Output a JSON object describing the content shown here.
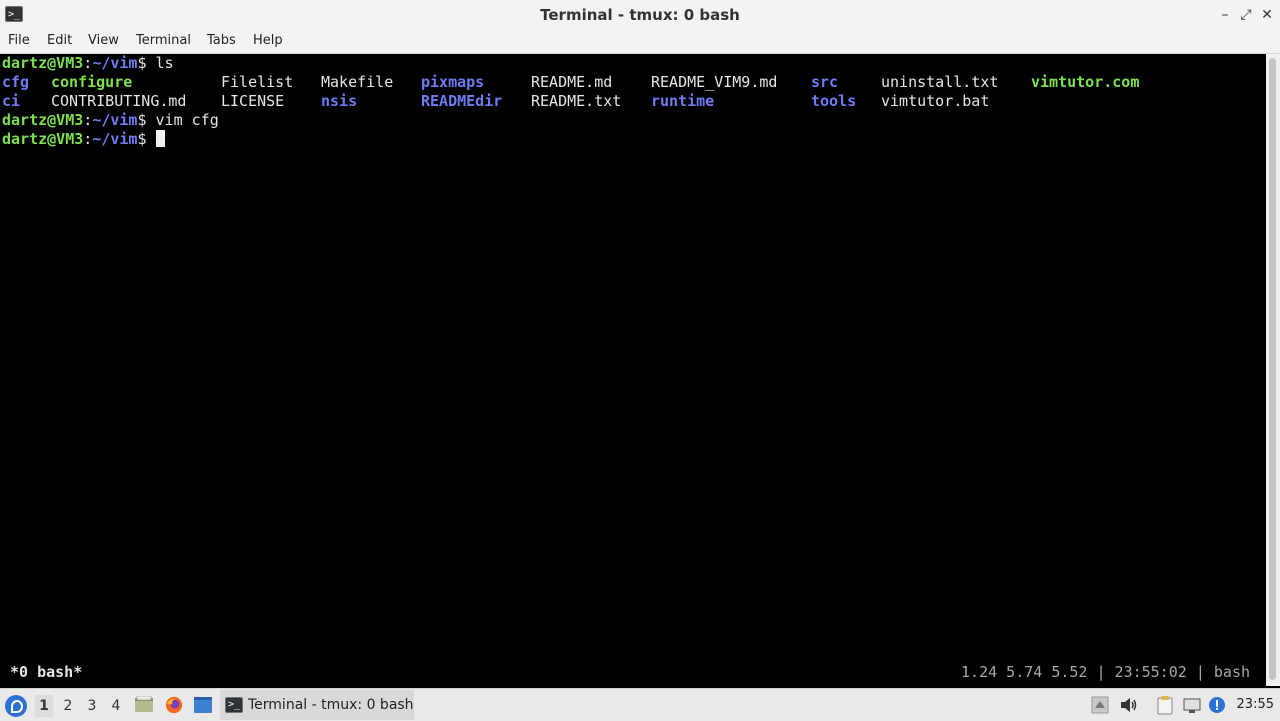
{
  "window": {
    "title": "Terminal - tmux: 0 bash",
    "app_icon_glyph": ">_",
    "controls": {
      "minimize": "–",
      "maximize": "⤢",
      "close": "✕"
    }
  },
  "menubar": {
    "items": [
      "File",
      "Edit",
      "View",
      "Terminal",
      "Tabs",
      "Help"
    ]
  },
  "terminal": {
    "prompt_user": "dartz@VM3",
    "prompt_sep": ":",
    "prompt_path": "~/vim",
    "prompt_end": "$",
    "commands": [
      " ls",
      " vim cfg",
      " "
    ],
    "ls_row1": [
      "cfg",
      "configure",
      "Filelist",
      "Makefile",
      "pixmaps",
      "README.md",
      "README_VIM9.md",
      "src",
      "uninstall.txt",
      "vimtutor.com"
    ],
    "ls_row2": [
      "ci",
      "CONTRIBUTING.md",
      "LICENSE",
      "nsis",
      "READMEdir",
      "README.txt",
      "runtime",
      "tools",
      "vimtutor.bat"
    ],
    "colors": {
      "directory": "#6e7cf2",
      "executable": "#7ce04f",
      "plain": "#e6e6e6"
    }
  },
  "tmux_status": {
    "left": "*0 bash*",
    "right": "1.24 5.74 5.52 | 23:55:02 | bash"
  },
  "taskbar": {
    "workspaces": [
      "1",
      "2",
      "3",
      "4"
    ],
    "active_workspace": "1",
    "task_label": "Terminal - tmux: 0 bash",
    "clock": "23:55"
  }
}
